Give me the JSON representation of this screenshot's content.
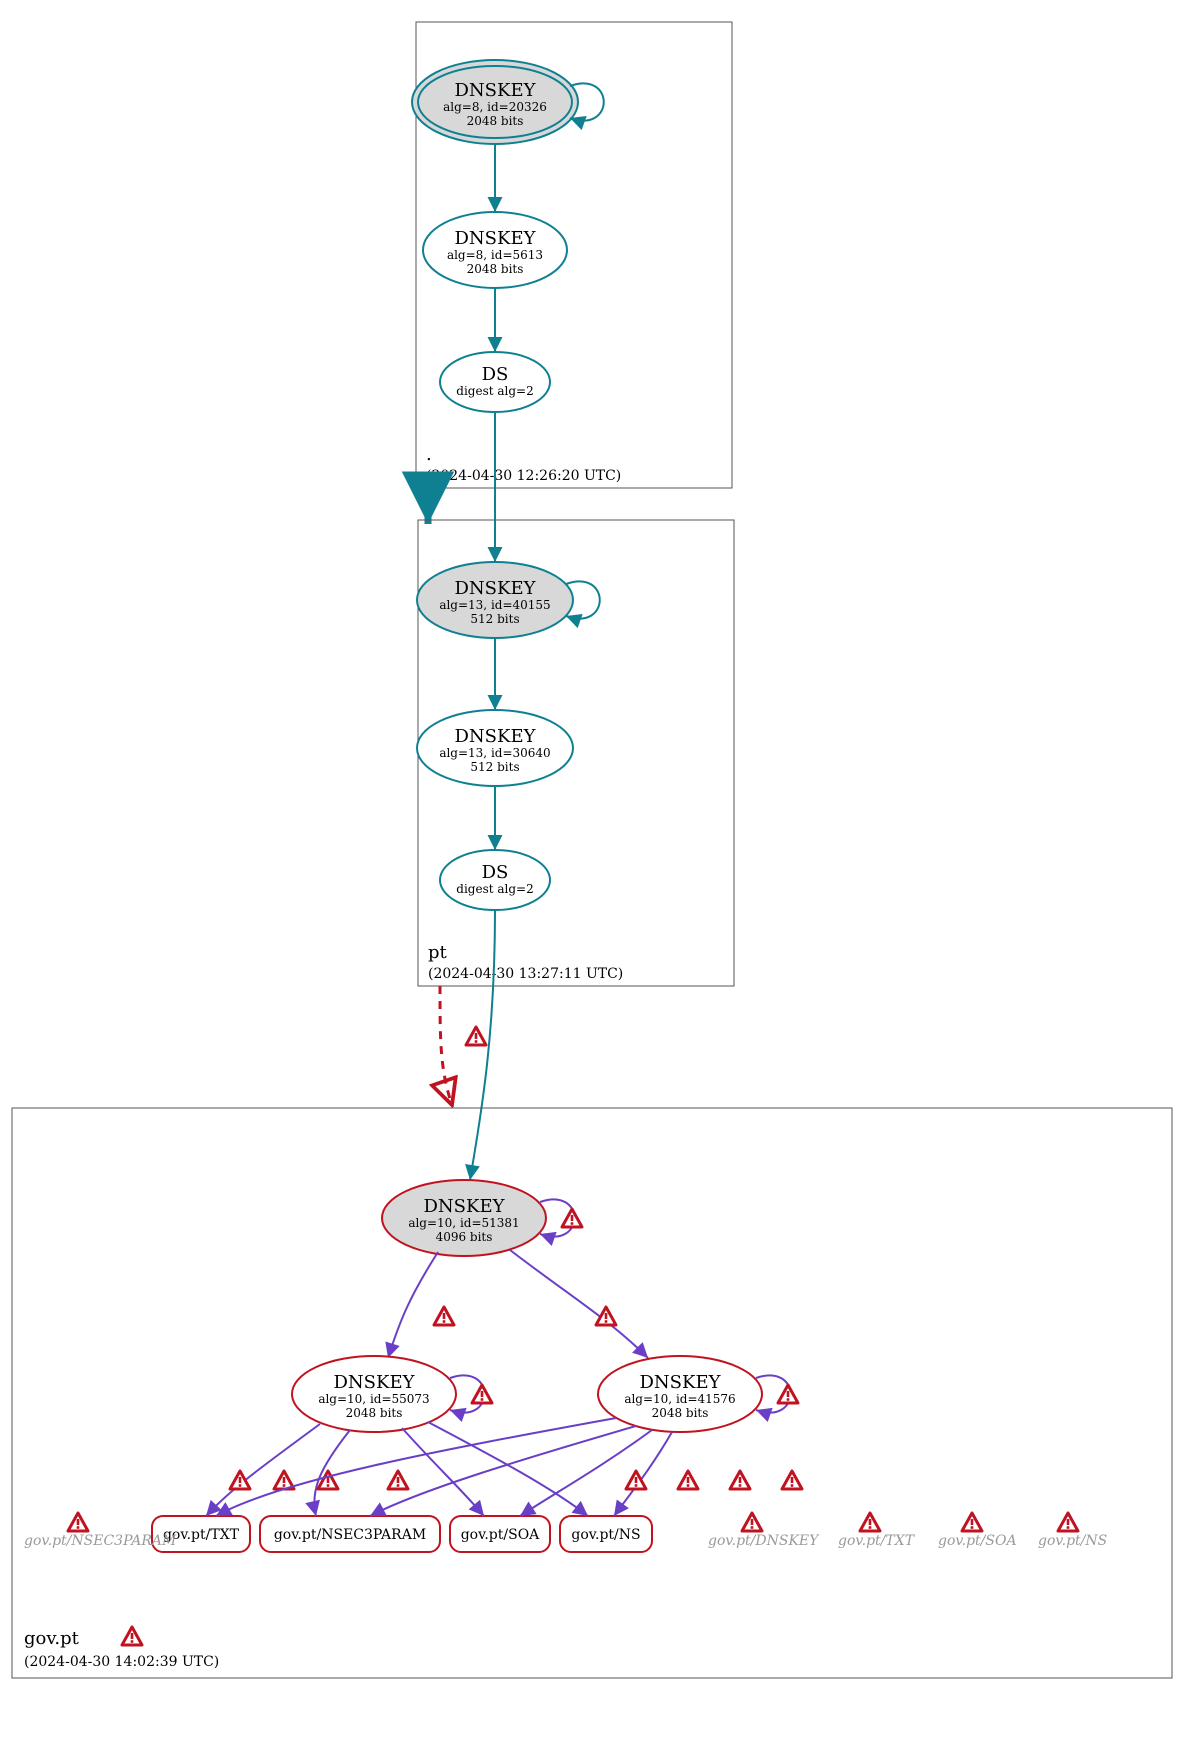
{
  "colors": {
    "teal": "#0f8091",
    "purple": "#6a3fc7",
    "red": "#c1121f",
    "grey": "#d8d8d8"
  },
  "zones": {
    "root": {
      "label": ".",
      "time": "(2024-04-30 12:26:20 UTC)"
    },
    "pt": {
      "label": "pt",
      "time": "(2024-04-30 13:27:11 UTC)"
    },
    "govpt": {
      "label": "gov.pt",
      "time": "(2024-04-30 14:02:39 UTC)"
    }
  },
  "nodes": {
    "root_ksk": {
      "title": "DNSKEY",
      "l2": "alg=8, id=20326",
      "l3": "2048 bits"
    },
    "root_zsk": {
      "title": "DNSKEY",
      "l2": "alg=8, id=5613",
      "l3": "2048 bits"
    },
    "root_ds": {
      "title": "DS",
      "l2": "digest alg=2"
    },
    "pt_ksk": {
      "title": "DNSKEY",
      "l2": "alg=13, id=40155",
      "l3": "512 bits"
    },
    "pt_zsk": {
      "title": "DNSKEY",
      "l2": "alg=13, id=30640",
      "l3": "512 bits"
    },
    "pt_ds": {
      "title": "DS",
      "l2": "digest alg=2"
    },
    "gov_ksk": {
      "title": "DNSKEY",
      "l2": "alg=10, id=51381",
      "l3": "4096 bits"
    },
    "gov_zsk1": {
      "title": "DNSKEY",
      "l2": "alg=10, id=55073",
      "l3": "2048 bits"
    },
    "gov_zsk2": {
      "title": "DNSKEY",
      "l2": "alg=10, id=41576",
      "l3": "2048 bits"
    }
  },
  "rr": {
    "txt": "gov.pt/TXT",
    "n3p": "gov.pt/NSEC3PARAM",
    "soa": "gov.pt/SOA",
    "ns": "gov.pt/NS"
  },
  "ghost": {
    "n3p": "gov.pt/NSEC3PARAM",
    "dnskey": "gov.pt/DNSKEY",
    "txt": "gov.pt/TXT",
    "soa": "gov.pt/SOA",
    "ns": "gov.pt/NS"
  }
}
